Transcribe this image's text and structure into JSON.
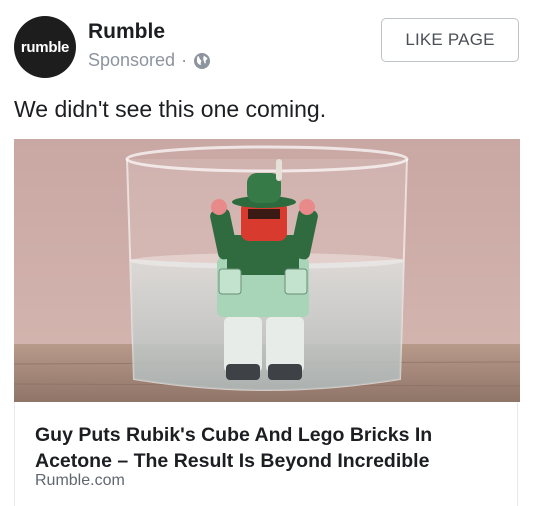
{
  "post": {
    "avatar_text": "rumble",
    "page_name": "Rumble",
    "sponsored": "Sponsored",
    "separator": "·",
    "privacy_icon": "globe-icon",
    "like_button": "LIKE PAGE",
    "message": "We didn't see this one coming."
  },
  "link_card": {
    "image_icon": "lego-figure-in-glass-photo",
    "headline": "Guy Puts Rubik's Cube And Lego Bricks In Acetone – The Result Is Beyond Incredible",
    "domain": "Rumble.com"
  },
  "colors": {
    "avatar_bg": "#1d1d1d",
    "text_primary": "#1c1e21",
    "text_secondary": "#8d949e",
    "button_border": "#bec3c9"
  }
}
